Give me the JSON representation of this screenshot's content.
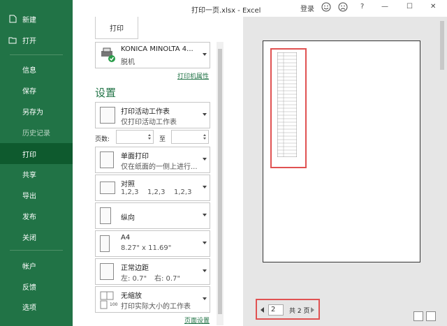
{
  "window": {
    "title": "打印一页.xlsx - Excel",
    "signin": "登录",
    "help": "?",
    "minimize": "—",
    "restore": "☐",
    "close": "✕"
  },
  "sidebar": {
    "items": [
      {
        "label": "新建"
      },
      {
        "label": "打开"
      },
      {
        "label": "信息"
      },
      {
        "label": "保存"
      },
      {
        "label": "另存为"
      },
      {
        "label": "历史记录"
      },
      {
        "label": "打印"
      },
      {
        "label": "共享"
      },
      {
        "label": "导出"
      },
      {
        "label": "发布"
      },
      {
        "label": "关闭"
      },
      {
        "label": "帐户"
      },
      {
        "label": "反馈"
      },
      {
        "label": "选项"
      }
    ]
  },
  "print": {
    "button_label": "打印",
    "printer": {
      "name": "KONICA MINOLTA 4...",
      "status": "脱机",
      "properties_link": "打印机属性"
    },
    "settings_title": "设置",
    "scope": {
      "line1": "打印活动工作表",
      "line2": "仅打印活动工作表"
    },
    "pages": {
      "label": "页数:",
      "to_label": "至",
      "from_value": "",
      "to_value": ""
    },
    "sides": {
      "line1": "单面打印",
      "line2": "仅在纸面的一侧上进行..."
    },
    "collate": {
      "line1": "对照",
      "line2a": "1,2,3",
      "line2b": "1,2,3",
      "line2c": "1,2,3"
    },
    "orientation": {
      "line1": "纵向"
    },
    "paper": {
      "line1": "A4",
      "line2": "8.27\" x 11.69\""
    },
    "margins": {
      "line1": "正常边距",
      "line2a": "左: 0.7\"",
      "line2b": "右: 0.7\""
    },
    "scaling": {
      "line1": "无缩放",
      "line2": "打印实际大小的工作表",
      "icon_text": "100"
    },
    "page_setup_link": "页面设置"
  },
  "preview": {
    "current_page": "2",
    "total_pages": "共 2 页"
  },
  "colors": {
    "accent": "#217346",
    "highlight": "#e05252"
  }
}
